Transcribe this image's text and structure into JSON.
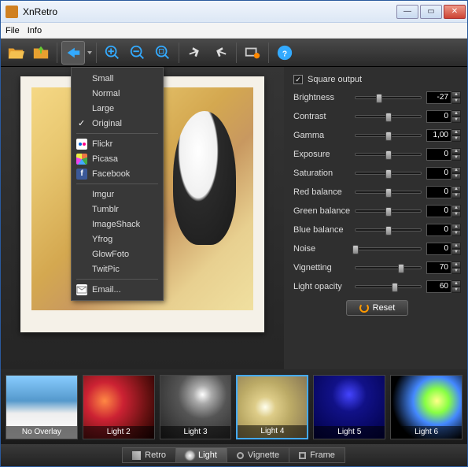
{
  "window": {
    "title": "XnRetro"
  },
  "menu": {
    "file": "File",
    "info": "Info"
  },
  "dropdown": {
    "sizes": [
      "Small",
      "Normal",
      "Large",
      "Original"
    ],
    "checked": "Original",
    "services": [
      {
        "label": "Flickr",
        "icon": "flickr"
      },
      {
        "label": "Picasa",
        "icon": "picasa"
      },
      {
        "label": "Facebook",
        "icon": "fb"
      }
    ],
    "uploads": [
      "Imgur",
      "Tumblr",
      "ImageShack",
      "Yfrog",
      "GlowFoto",
      "TwitPic"
    ],
    "email": "Email..."
  },
  "panel": {
    "square_output": "Square output",
    "square_checked": true,
    "sliders": [
      {
        "label": "Brightness",
        "value": "-27",
        "pos": 36
      },
      {
        "label": "Contrast",
        "value": "0",
        "pos": 50
      },
      {
        "label": "Gamma",
        "value": "1,00",
        "pos": 50
      },
      {
        "label": "Exposure",
        "value": "0",
        "pos": 50
      },
      {
        "label": "Saturation",
        "value": "0",
        "pos": 50
      },
      {
        "label": "Red balance",
        "value": "0",
        "pos": 50
      },
      {
        "label": "Green balance",
        "value": "0",
        "pos": 50
      },
      {
        "label": "Blue balance",
        "value": "0",
        "pos": 50
      },
      {
        "label": "Noise",
        "value": "0",
        "pos": 0
      },
      {
        "label": "Vignetting",
        "value": "70",
        "pos": 70
      },
      {
        "label": "Light opacity",
        "value": "60",
        "pos": 60
      }
    ],
    "reset": "Reset"
  },
  "thumbs": [
    {
      "label": "No Overlay",
      "cls": "t-no",
      "sel": false
    },
    {
      "label": "Light 2",
      "cls": "t-l2",
      "sel": false
    },
    {
      "label": "Light 3",
      "cls": "t-l3",
      "sel": false
    },
    {
      "label": "Light 4",
      "cls": "t-l4",
      "sel": true
    },
    {
      "label": "Light 5",
      "cls": "t-l5",
      "sel": false
    },
    {
      "label": "Light 6",
      "cls": "t-l6",
      "sel": false
    }
  ],
  "tabs": [
    {
      "label": "Retro",
      "icon": "retro",
      "sel": false
    },
    {
      "label": "Light",
      "icon": "light",
      "sel": true
    },
    {
      "label": "Vignette",
      "icon": "vig",
      "sel": false
    },
    {
      "label": "Frame",
      "icon": "frame",
      "sel": false
    }
  ]
}
